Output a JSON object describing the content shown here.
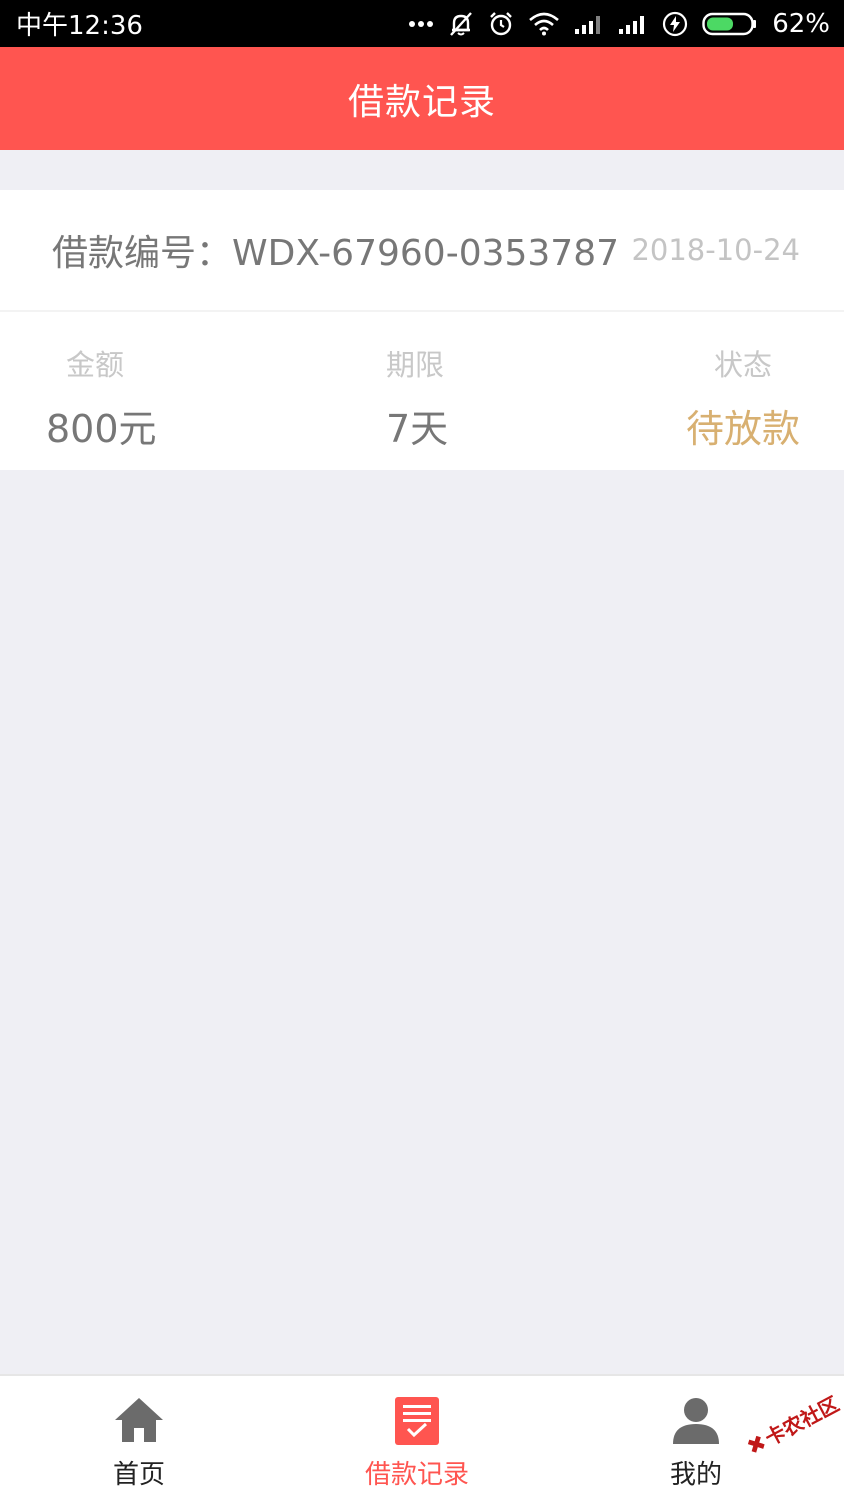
{
  "status_bar": {
    "time": "中午12:36",
    "icons": [
      "more-dots-icon",
      "bell-off-icon",
      "alarm-icon",
      "wifi-icon",
      "signal-icon",
      "signal-icon",
      "charging-icon",
      "battery-icon"
    ],
    "battery": "62%",
    "battery_level": 0.62
  },
  "header": {
    "title": "借款记录"
  },
  "record": {
    "number": "借款编号：WDX-67960-0353787",
    "date": "2018-10-24",
    "amount_label": "金额",
    "amount_value": "800元",
    "term_label": "期限",
    "term_value": "7天",
    "status_label": "状态",
    "status_value": "待放款"
  },
  "tabbar": {
    "tabs": [
      {
        "label": "首页",
        "icon": "home-icon",
        "active": false
      },
      {
        "label": "借款记录",
        "icon": "record-list-icon",
        "active": true
      },
      {
        "label": "我的",
        "icon": "user-icon",
        "active": false
      }
    ]
  },
  "watermark": {
    "text": "卡农社区"
  },
  "colors": {
    "accent": "#ff5550",
    "status_pending": "#d8b071",
    "background": "#efeff4"
  }
}
